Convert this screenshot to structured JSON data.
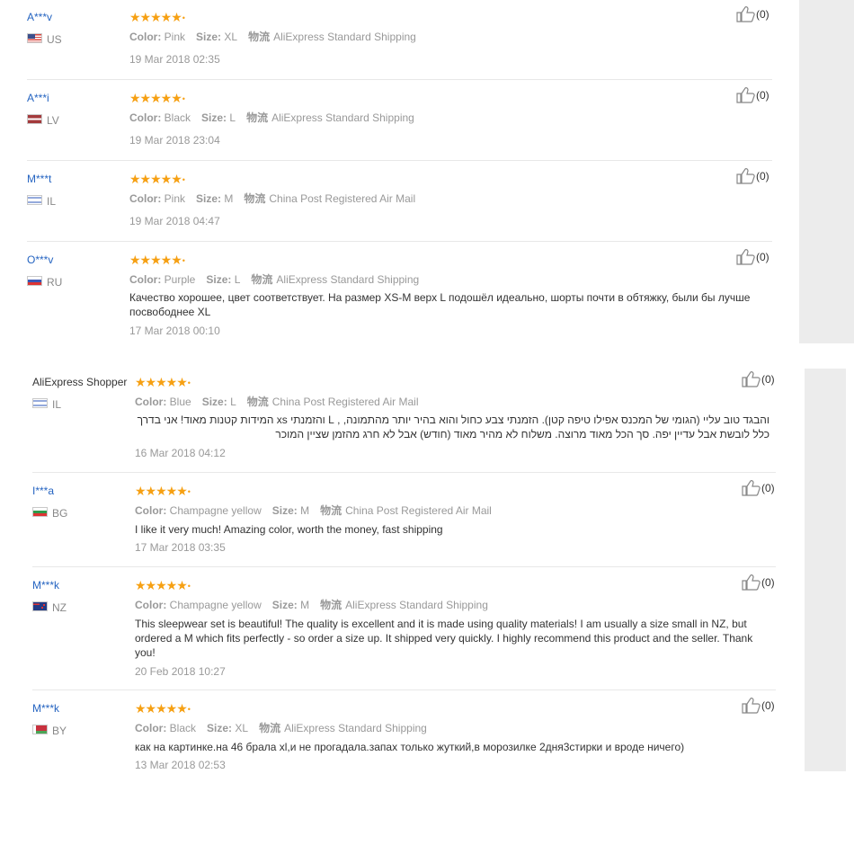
{
  "labels": {
    "color": "Color:",
    "size": "Size:",
    "logistics": "物流"
  },
  "reviews": [
    {
      "user": "A***v",
      "country": "US",
      "stars": "★★★★★",
      "color": "Pink",
      "size": "XL",
      "shipping": "AliExpress Standard Shipping",
      "feedback": "",
      "date": "19 Mar 2018 02:35",
      "helpful": "(0)"
    },
    {
      "user": "A***i",
      "country": "LV",
      "stars": "★★★★★",
      "color": "Black",
      "size": "L",
      "shipping": "AliExpress Standard Shipping",
      "feedback": "",
      "date": "19 Mar 2018 23:04",
      "helpful": "(0)"
    },
    {
      "user": "M***t",
      "country": "IL",
      "stars": "★★★★★",
      "color": "Pink",
      "size": "M",
      "shipping": "China Post Registered Air Mail",
      "feedback": "",
      "date": "19 Mar 2018 04:47",
      "helpful": "(0)"
    },
    {
      "user": "O***v",
      "country": "RU",
      "stars": "★★★★★",
      "color": "Purple",
      "size": "L",
      "shipping": "AliExpress Standard Shipping",
      "feedback": "Качество хорошее, цвет соответствует. На размер XS-M верх L подошёл идеально, шорты почти в обтяжку, были бы лучше посвободнее XL",
      "date": "17 Mar 2018 00:10",
      "helpful": "(0)"
    },
    {
      "user": "AliExpress Shopper",
      "country": "IL",
      "stars": "★★★★★",
      "color": "Blue",
      "size": "L",
      "shipping": "China Post Registered Air Mail",
      "feedback": "והבגד טוב עליי (הגומי של המכנס אפילו טיפה קטן). הזמנתי צבע כחול והוא בהיר יותר מהתמונה, , L והזמנתי xs המידות קטנות מאוד! אני בדרך כלל לובשת אבל עדיין יפה. סך הכל מאוד מרוצה. משלוח לא מהיר מאוד (חודש) אבל לא חרג מהזמן שציין המוכר",
      "date": "16 Mar 2018 04:12",
      "helpful": "(0)"
    },
    {
      "user": "I***a",
      "country": "BG",
      "stars": "★★★★★",
      "color": "Champagne yellow",
      "size": "M",
      "shipping": "China Post Registered Air Mail",
      "feedback": "I like it very much! Amazing color, worth the money, fast shipping",
      "date": "17 Mar 2018 03:35",
      "helpful": "(0)"
    },
    {
      "user": "M***k",
      "country": "NZ",
      "stars": "★★★★★",
      "color": "Champagne yellow",
      "size": "M",
      "shipping": "AliExpress Standard Shipping",
      "feedback": "This sleepwear set is beautiful! The quality is excellent and it is made using quality materials! I am usually a size small in NZ, but ordered a M which fits perfectly - so order a size up. It shipped very quickly. I highly recommend this product and the seller. Thank you!",
      "date": "20 Feb 2018 10:27",
      "helpful": "(0)"
    },
    {
      "user": "M***k",
      "country": "BY",
      "stars": "★★★★★",
      "color": "Black",
      "size": "XL",
      "shipping": "AliExpress Standard Shipping",
      "feedback": "как на картинке.на 46 брала xl,и не прогадала.запах только жуткий,в морозилке 2дня3стирки и вроде ничего)",
      "date": "13 Mar 2018 02:53",
      "helpful": "(0)"
    }
  ],
  "colors": {
    "link": "#2564c1",
    "star": "#f6a013",
    "muted": "#999999",
    "sidebar": "#ececec"
  }
}
